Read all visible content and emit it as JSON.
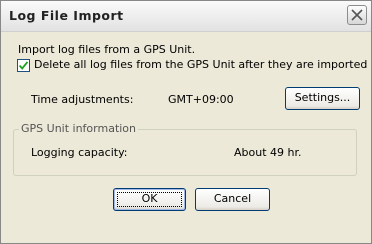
{
  "dialog": {
    "title": "Log File Import",
    "intro": "Import log files from a GPS Unit.",
    "delete_checkbox": {
      "label": "Delete all log files from the GPS Unit after they are imported",
      "checked": true
    },
    "time_adjustments": {
      "label": "Time adjustments:",
      "value": "GMT+09:00",
      "settings_button": "Settings..."
    },
    "gps_info": {
      "group_label": "GPS Unit information",
      "capacity_label": "Logging capacity:",
      "capacity_value": "About 49 hr."
    },
    "buttons": {
      "ok": "OK",
      "cancel": "Cancel"
    }
  }
}
